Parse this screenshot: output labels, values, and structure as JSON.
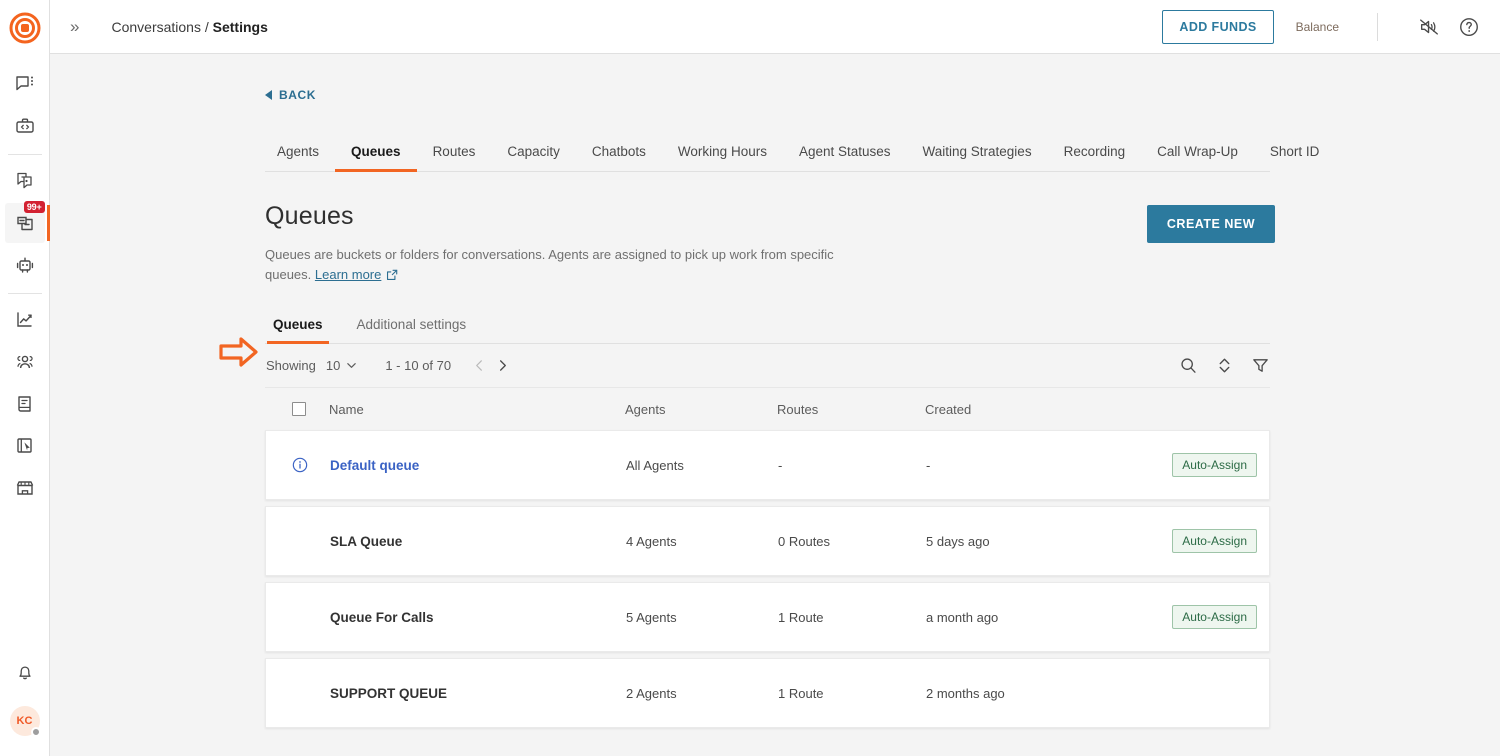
{
  "app": {
    "logo_icon": "target-logo-icon",
    "expand_icon": "double-chevron-right-icon"
  },
  "breadcrumb": {
    "root": "Conversations",
    "separator": "/",
    "current": "Settings"
  },
  "topbar": {
    "add_funds_label": "ADD FUNDS",
    "balance_label": "Balance",
    "mute_icon": "speaker-muted-icon",
    "help_icon": "question-circle-icon"
  },
  "sidebar": {
    "items": [
      {
        "name": "conversations",
        "icon": "chat-bubble-icon",
        "active": false,
        "badge": ""
      },
      {
        "name": "developer",
        "icon": "briefcase-code-icon",
        "active": false,
        "badge": ""
      },
      {
        "name": "broadcast",
        "icon": "copy-chat-icon",
        "active": false,
        "badge": ""
      },
      {
        "name": "inbox",
        "icon": "inbox-tray-icon",
        "active": true,
        "badge": "99+"
      },
      {
        "name": "chatbot",
        "icon": "robot-icon",
        "active": false,
        "badge": ""
      },
      {
        "name": "analytics",
        "icon": "line-chart-icon",
        "active": false,
        "badge": ""
      },
      {
        "name": "contacts",
        "icon": "people-group-icon",
        "active": false,
        "badge": ""
      },
      {
        "name": "knowledge-base",
        "icon": "book-icon",
        "active": false,
        "badge": ""
      },
      {
        "name": "flows",
        "icon": "cursor-board-icon",
        "active": false,
        "badge": ""
      },
      {
        "name": "marketplace",
        "icon": "storefront-icon",
        "active": false,
        "badge": ""
      }
    ],
    "notifications_icon": "bell-icon",
    "avatar_initials": "KC"
  },
  "back": {
    "label": "BACK",
    "icon": "triangle-left-icon"
  },
  "tabs": [
    {
      "label": "Agents",
      "active": false
    },
    {
      "label": "Queues",
      "active": true
    },
    {
      "label": "Routes",
      "active": false
    },
    {
      "label": "Capacity",
      "active": false
    },
    {
      "label": "Chatbots",
      "active": false
    },
    {
      "label": "Working Hours",
      "active": false
    },
    {
      "label": "Agent Statuses",
      "active": false
    },
    {
      "label": "Waiting Strategies",
      "active": false
    },
    {
      "label": "Recording",
      "active": false
    },
    {
      "label": "Call Wrap-Up",
      "active": false
    },
    {
      "label": "Short ID",
      "active": false
    }
  ],
  "page": {
    "title": "Queues",
    "description_part1": "Queues are buckets or folders for conversations. Agents are assigned to pick up work from specific queues.",
    "learn_more": "Learn more",
    "learn_more_icon": "external-link-icon",
    "create_button": "CREATE NEW"
  },
  "subtabs": [
    {
      "label": "Queues",
      "active": true
    },
    {
      "label": "Additional settings",
      "active": false
    }
  ],
  "toolbar": {
    "showing_label": "Showing",
    "page_size": "10",
    "page_size_icon": "chevron-down-icon",
    "range": "1 - 10 of 70",
    "prev_icon": "chevron-left-icon",
    "next_icon": "chevron-right-icon",
    "search_icon": "search-icon",
    "sort_icon": "sort-updown-icon",
    "filter_icon": "filter-funnel-icon"
  },
  "table": {
    "select_all_checkbox": "unchecked",
    "columns": [
      "Name",
      "Agents",
      "Routes",
      "Created"
    ],
    "rows": [
      {
        "info_icon": "info-circle-icon",
        "has_info": true,
        "name": "Default queue",
        "name_is_link": true,
        "agents": "All Agents",
        "routes": "-",
        "created": "-",
        "badge": "Auto-Assign"
      },
      {
        "info_icon": "",
        "has_info": false,
        "name": "SLA Queue",
        "name_is_link": false,
        "agents": "4 Agents",
        "routes": "0 Routes",
        "created": "5 days ago",
        "badge": "Auto-Assign"
      },
      {
        "info_icon": "",
        "has_info": false,
        "name": "Queue For Calls",
        "name_is_link": false,
        "agents": "5 Agents",
        "routes": "1 Route",
        "created": "a month ago",
        "badge": "Auto-Assign"
      },
      {
        "info_icon": "",
        "has_info": false,
        "name": "SUPPORT QUEUE",
        "name_is_link": false,
        "agents": "2 Agents",
        "routes": "1 Route",
        "created": "2 months ago",
        "badge": ""
      }
    ]
  },
  "annotation": {
    "icon": "orange-arrow-right-annotation"
  },
  "colors": {
    "brand_orange": "#f26522",
    "accent_teal": "#2c7a9e",
    "link_blue": "#3a62c4",
    "badge_green_text": "#2c6b46",
    "badge_green_bg": "#eef6ef",
    "badge_red": "#d32232"
  }
}
